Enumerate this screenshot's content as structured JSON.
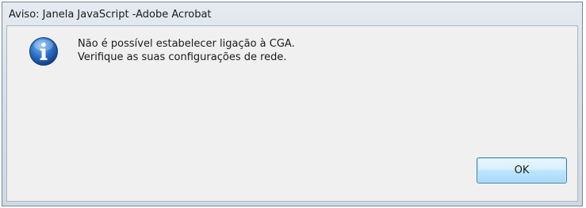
{
  "window": {
    "title": "Aviso: Janela JavaScript -Adobe Acrobat"
  },
  "dialog": {
    "icon": "info-icon",
    "message_line1": "Não é possível estabelecer ligação à CGA.",
    "message_line2": "Verifique as suas configurações de rede.",
    "ok_label": "OK"
  },
  "colors": {
    "icon_blue": "#1e5fb3",
    "button_border": "#3c7fb1"
  }
}
